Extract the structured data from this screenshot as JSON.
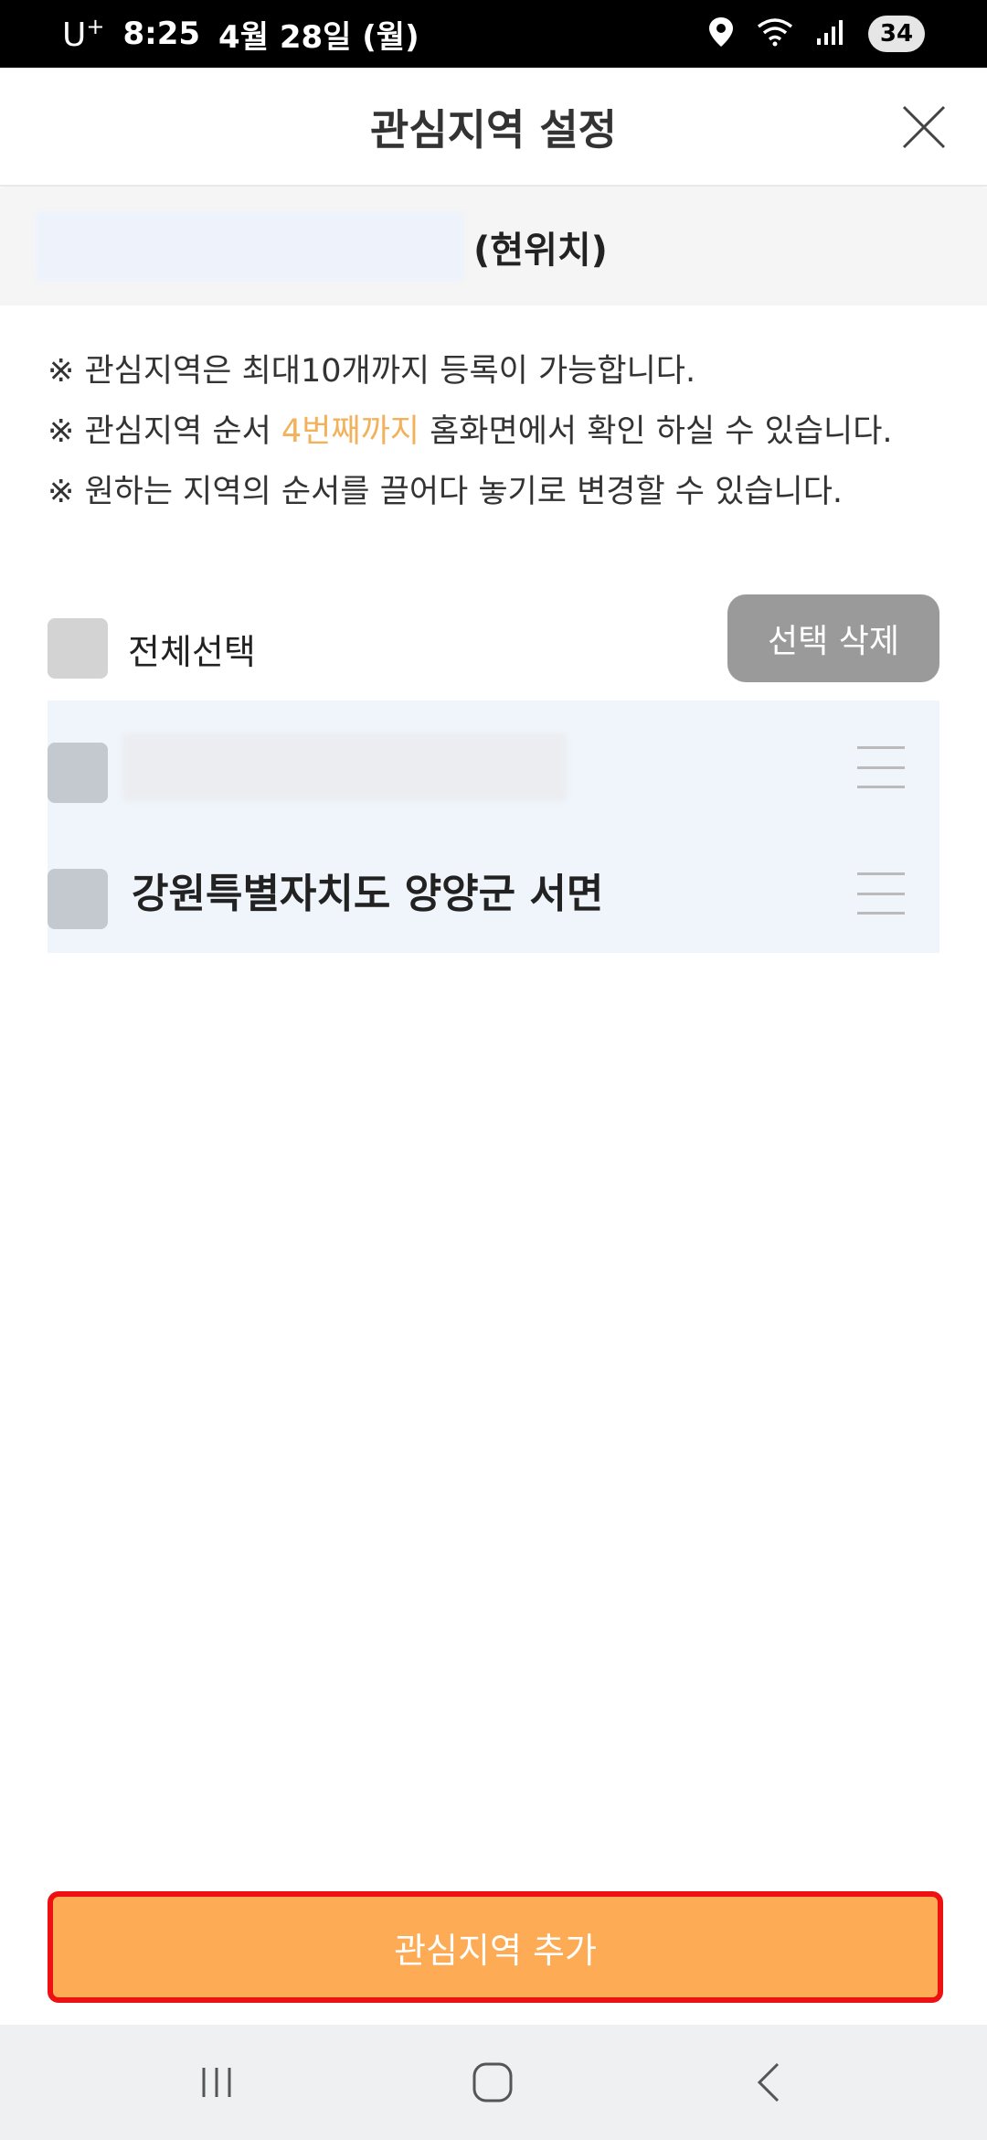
{
  "status_bar": {
    "carrier": "U",
    "carrier_plus": "+",
    "time": "8:25",
    "date": "4월 28일 (월)",
    "battery": "34"
  },
  "header": {
    "title": "관심지역 설정"
  },
  "current_location": {
    "label": "(현위치)"
  },
  "notices": {
    "line1": "※ 관심지역은 최대10개까지 등록이 가능합니다.",
    "line2_prefix": "※ 관심지역 순서 ",
    "line2_highlight": "4번째까지",
    "line2_suffix": " 홈화면에서 확인 하실 수 있습니다.",
    "line3": "※ 원하는 지역의 순서를 끌어다 놓기로 변경할 수 있습니다."
  },
  "select_all": {
    "label": "전체선택",
    "delete_button": "선택 삭제"
  },
  "regions": [
    {
      "name": ""
    },
    {
      "name": "강원특별자치도 양양군 서면"
    }
  ],
  "add_button": {
    "label": "관심지역 추가"
  },
  "colors": {
    "accent_orange": "#fdab54",
    "highlight_text": "#f2b15a",
    "focus_outline": "#ee1111",
    "list_background": "#f0f5fb"
  },
  "icons": {
    "close": "close-icon",
    "drag": "drag-handle-icon",
    "location": "location-pin-icon",
    "wifi": "wifi-icon",
    "signal": "signal-icon",
    "nav_recent": "recent-apps-icon",
    "nav_home": "home-icon",
    "nav_back": "back-icon"
  }
}
